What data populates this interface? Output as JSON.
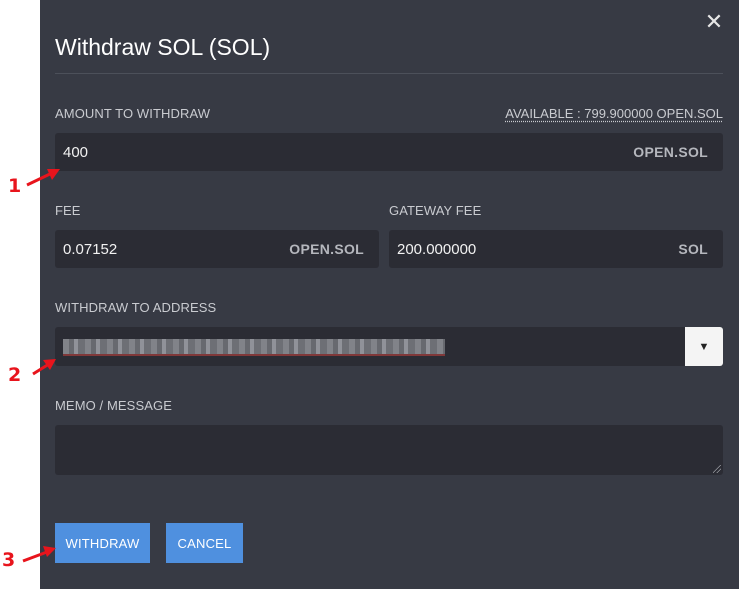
{
  "dialog": {
    "title": "Withdraw SOL (SOL)",
    "close_glyph": "✕"
  },
  "amount": {
    "label": "AMOUNT TO WITHDRAW",
    "available": "AVAILABLE : 799.900000 OPEN.SOL",
    "value": "400",
    "unit": "OPEN.SOL"
  },
  "fee": {
    "label": "FEE",
    "value": "0.07152",
    "unit": "OPEN.SOL"
  },
  "gateway_fee": {
    "label": "GATEWAY FEE",
    "value": "200.000000",
    "unit": "SOL"
  },
  "address": {
    "label": "WITHDRAW TO ADDRESS",
    "dropdown_glyph": "▼"
  },
  "memo": {
    "label": "MEMO / MESSAGE",
    "value": ""
  },
  "buttons": {
    "withdraw": "WITHDRAW",
    "cancel": "CANCEL"
  },
  "annotations": {
    "marker_1": "1",
    "marker_2": "2",
    "marker_3": "3",
    "color": "#e8141c"
  },
  "colors": {
    "modal_bg": "#373a44",
    "field_bg": "#2b2c34",
    "button": "#4f90df"
  }
}
